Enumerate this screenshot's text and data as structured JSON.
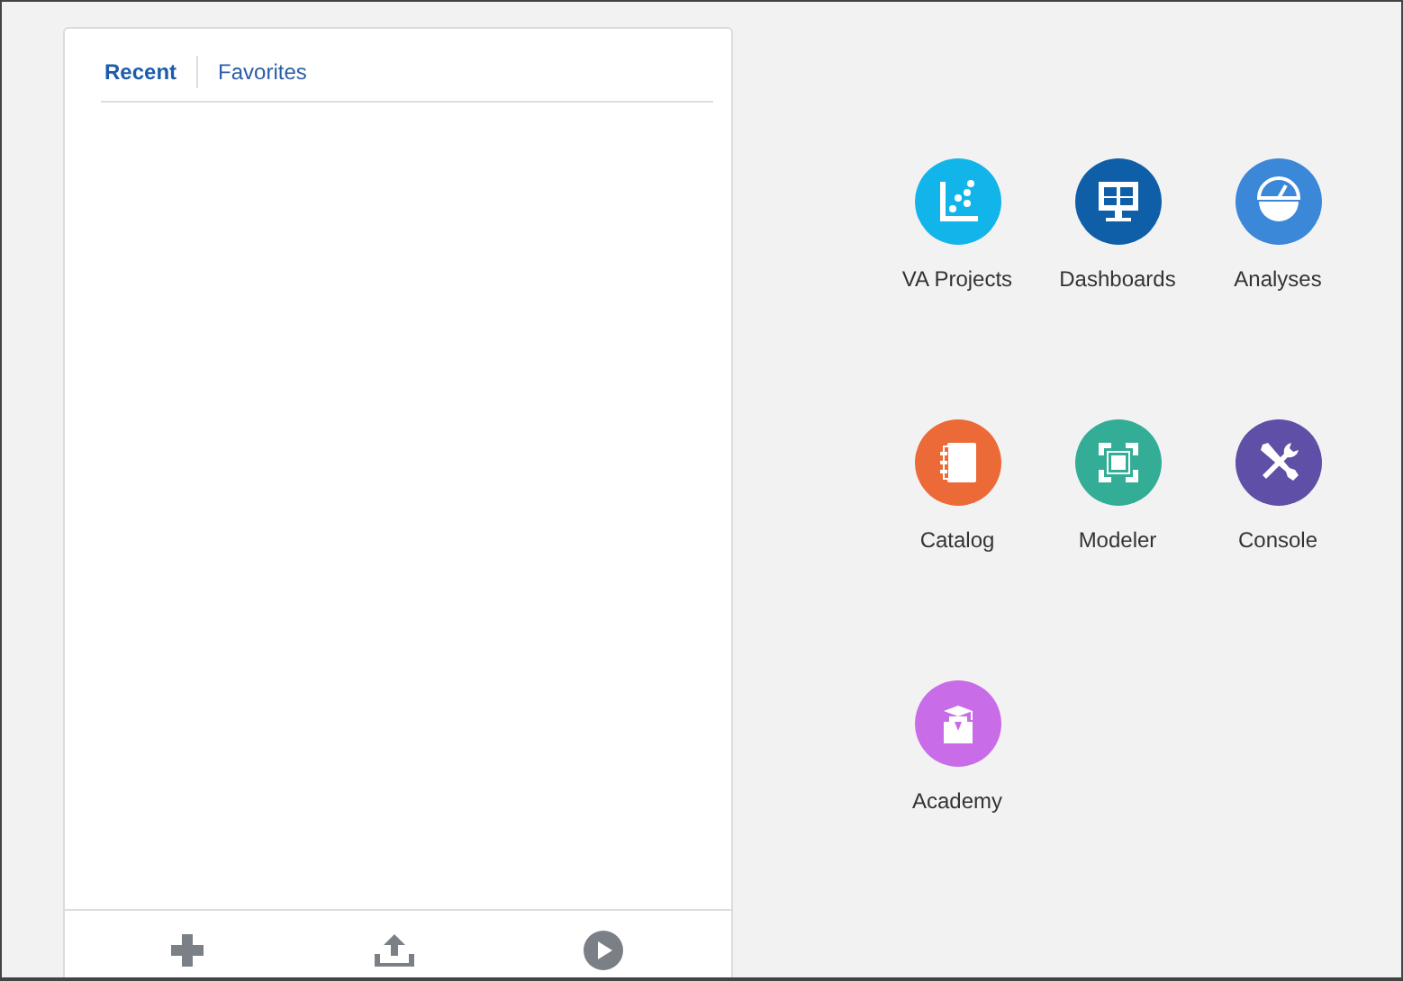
{
  "panel": {
    "tabs": [
      {
        "label": "Recent",
        "selected": true
      },
      {
        "label": "Favorites",
        "selected": false
      }
    ],
    "footer_buttons": [
      {
        "kind": "add"
      },
      {
        "kind": "upload"
      },
      {
        "kind": "play"
      }
    ]
  },
  "tiles": [
    {
      "label": "VA Projects",
      "kind": "scatter",
      "color": "#12b5ea"
    },
    {
      "label": "Dashboards",
      "kind": "monitor",
      "color": "#0f5fa8"
    },
    {
      "label": "Analyses",
      "kind": "gauge",
      "color": "#3b87d8"
    },
    {
      "label": "Catalog",
      "kind": "notebook",
      "color": "#ec6a37"
    },
    {
      "label": "Modeler",
      "kind": "model",
      "color": "#33ad96"
    },
    {
      "label": "Console",
      "kind": "tools",
      "color": "#5f4fa6"
    },
    {
      "label": "Academy",
      "kind": "academy",
      "color": "#c86ce8"
    }
  ]
}
